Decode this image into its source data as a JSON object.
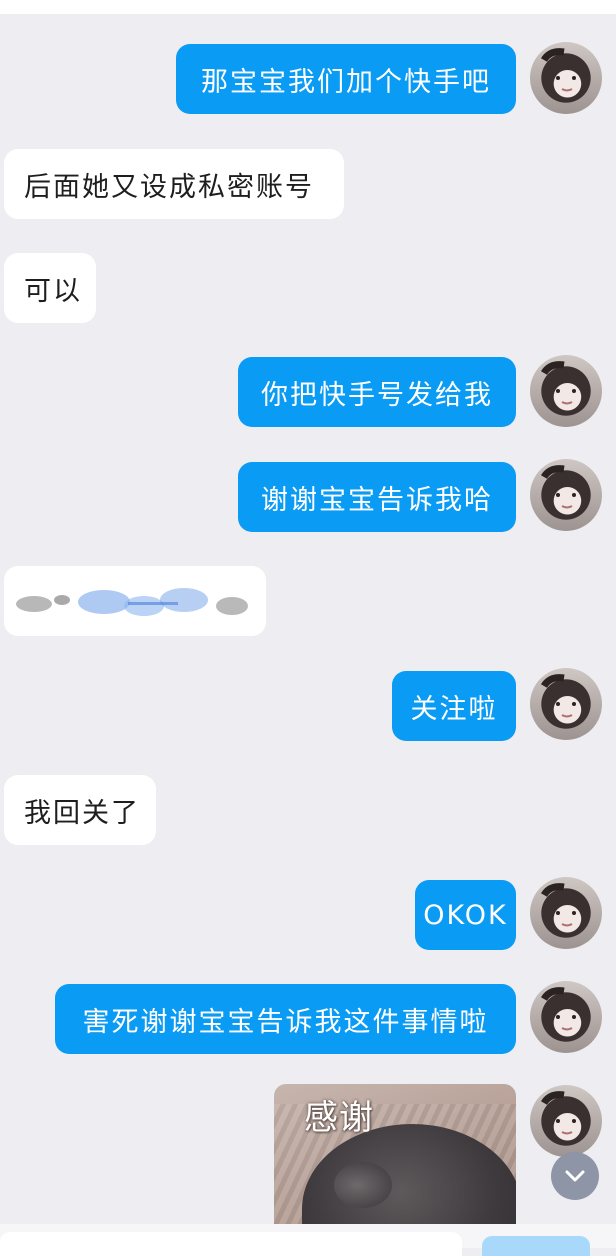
{
  "messages": [
    {
      "side": "out",
      "text": "那宝宝我们加个快手吧"
    },
    {
      "side": "in",
      "text": "后面她又设成私密账号"
    },
    {
      "side": "in",
      "text": "可以"
    },
    {
      "side": "out",
      "text": "你把快手号发给我"
    },
    {
      "side": "out",
      "text": "谢谢宝宝告诉我哈"
    },
    {
      "side": "out",
      "text": "关注啦"
    },
    {
      "side": "in",
      "text": "我回关了"
    },
    {
      "side": "out",
      "text": "OKOK"
    },
    {
      "side": "out",
      "text": "害死谢谢宝宝告诉我这件事情啦"
    }
  ],
  "sticker": {
    "caption": "感谢"
  },
  "colors": {
    "outgoing": "#0A9BF4",
    "incoming": "#FFFFFF",
    "background": "#EDEDF2"
  },
  "icons": {
    "scroll": "chevron-down-icon"
  }
}
